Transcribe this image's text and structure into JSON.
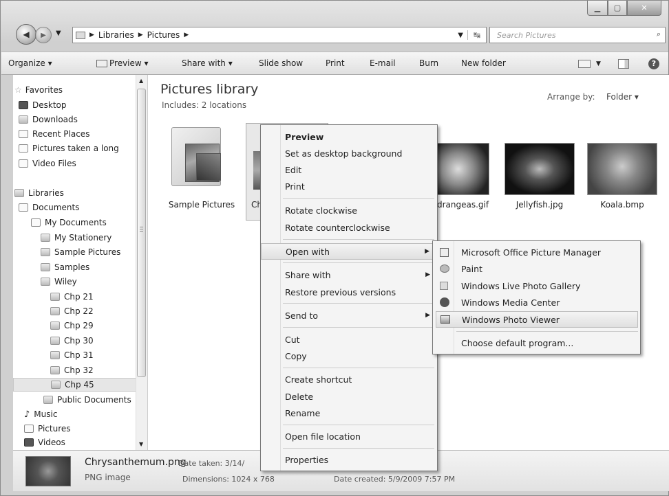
{
  "address": {
    "crumbs": [
      "Libraries",
      "Pictures"
    ]
  },
  "search": {
    "placeholder": "Search Pictures"
  },
  "toolbar": {
    "organize": "Organize ▾",
    "preview": "Preview ▾",
    "share_with": "Share with ▾",
    "slide_show": "Slide show",
    "print": "Print",
    "email": "E-mail",
    "burn": "Burn",
    "new_folder": "New folder"
  },
  "nav": {
    "favorites": "Favorites",
    "desktop": "Desktop",
    "downloads": "Downloads",
    "recent": "Recent Places",
    "pictures_taken": "Pictures taken a long",
    "video_files": "Video Files",
    "libraries": "Libraries",
    "documents": "Documents",
    "my_documents": "My Documents",
    "my_stationery": "My Stationery",
    "sample_pictures": "Sample Pictures",
    "samples": "Samples",
    "wiley": "Wiley",
    "chp21": "Chp 21",
    "chp22": "Chp 22",
    "chp29": "Chp 29",
    "chp30": "Chp 30",
    "chp31": "Chp 31",
    "chp32": "Chp 32",
    "chp45": "Chp 45",
    "public_documents": "Public Documents",
    "music": "Music",
    "pictures": "Pictures",
    "videos": "Videos"
  },
  "library": {
    "title": "Pictures library",
    "includes": "Includes:  2 locations",
    "arrange_label": "Arrange by:",
    "arrange_value": "Folder ▾"
  },
  "files": {
    "sample_pictures": "Sample Pictures",
    "chrysanthemum": "Ch",
    "hydrangeas": "drangeas.gif",
    "jellyfish": "Jellyfish.jpg",
    "koala": "Koala.bmp"
  },
  "details": {
    "filename": "Chrysanthemum.png",
    "filetype": "PNG image",
    "date_taken": "Date taken: 3/14/",
    "dimensions": "Dimensions: 1024 x 768",
    "date_created": "Date created: 5/9/2009 7:57 PM"
  },
  "context_menu": {
    "preview": "Preview",
    "set_background": "Set as desktop background",
    "edit": "Edit",
    "print": "Print",
    "rotate_cw": "Rotate clockwise",
    "rotate_ccw": "Rotate counterclockwise",
    "open_with": "Open with",
    "share_with": "Share with",
    "restore": "Restore previous versions",
    "send_to": "Send to",
    "cut": "Cut",
    "copy": "Copy",
    "create_shortcut": "Create shortcut",
    "delete": "Delete",
    "rename": "Rename",
    "open_location": "Open file location",
    "properties": "Properties"
  },
  "open_with_menu": {
    "office_picture_manager": "Microsoft Office Picture Manager",
    "paint": "Paint",
    "live_photo_gallery": "Windows Live Photo Gallery",
    "media_center": "Windows Media Center",
    "photo_viewer": "Windows Photo Viewer",
    "choose_default": "Choose default program..."
  }
}
